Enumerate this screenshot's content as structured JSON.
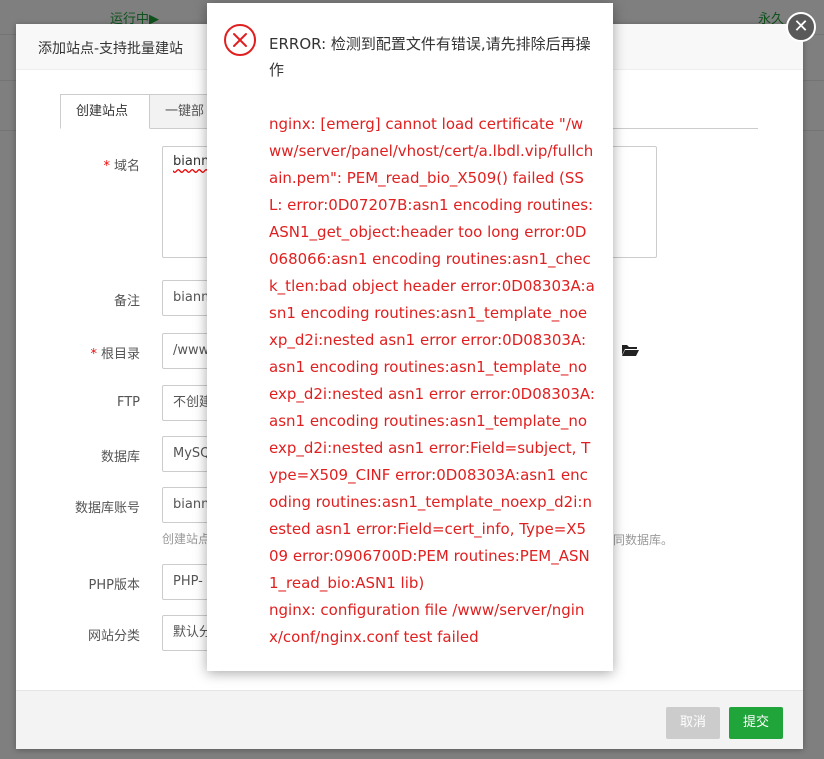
{
  "background": {
    "status_text": "运行中▶",
    "expire_text": "永久"
  },
  "dialog": {
    "title": "添加站点-支持批量建站",
    "close_glyph": "✕",
    "tabs": [
      {
        "label": "创建站点"
      },
      {
        "label": "一键部"
      }
    ],
    "fields": {
      "domain": {
        "label": "域名",
        "value": "bianm"
      },
      "remark": {
        "label": "备注",
        "value": "bianm"
      },
      "root_dir": {
        "label": "根目录",
        "value": "/www"
      },
      "ftp": {
        "label": "FTP",
        "value": "不创建"
      },
      "database": {
        "label": "数据库",
        "value": "MySQ"
      },
      "db_account": {
        "label": "数据库账号",
        "value": "bianm"
      },
      "db_help_left": "创建站点",
      "db_help_right": "同数据库。",
      "php_version": {
        "label": "PHP版本",
        "value": "PHP-"
      },
      "site_category": {
        "label": "网站分类",
        "value": "默认分"
      }
    },
    "required_mark": "*",
    "buttons": {
      "cancel": "取消",
      "submit": "提交"
    }
  },
  "error_popup": {
    "title": "ERROR: 检测到配置文件有错误,请先排除后再操作",
    "message_line1": "nginx: [emerg] cannot load certificate \"/www/server/panel/vhost/cert/a.lbdl.vip/fullchain.pem\": PEM_read_bio_X509() failed (SSL: error:0D07207B:asn1 encoding routines:ASN1_get_object:header too long error:0D068066:asn1 encoding routines:asn1_check_tlen:bad object header error:0D08303A:asn1 encoding routines:asn1_template_noexp_d2i:nested asn1 error error:0D08303A:asn1 encoding routines:asn1_template_noexp_d2i:nested asn1 error error:0D08303A:asn1 encoding routines:asn1_template_noexp_d2i:nested asn1 error:Field=subject, Type=X509_CINF error:0D08303A:asn1 encoding routines:asn1_template_noexp_d2i:nested asn1 error:Field=cert_info, Type=X509 error:0906700D:PEM routines:PEM_ASN1_read_bio:ASN1 lib)",
    "message_line2": "nginx: configuration file /www/server/nginx/conf/nginx.conf test failed",
    "colors": {
      "error": "#e02020",
      "icon": "#e02020"
    }
  },
  "colors": {
    "accent": "#20a53a",
    "required": "#ef0808"
  }
}
